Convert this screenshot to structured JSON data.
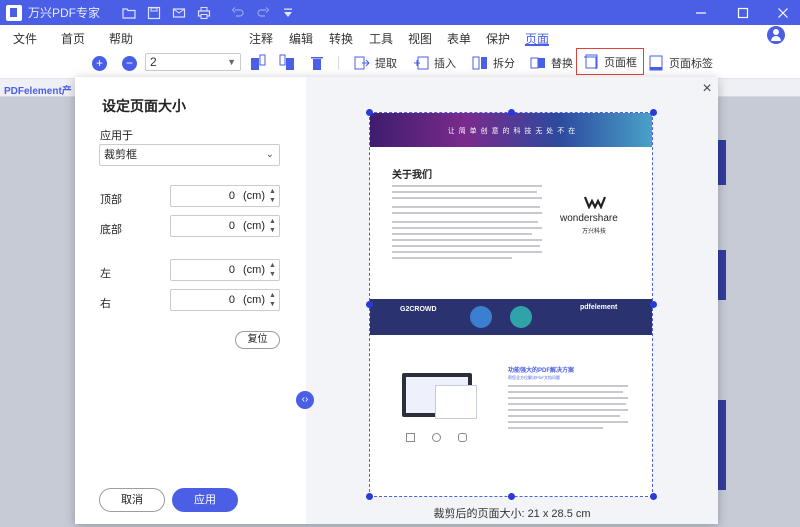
{
  "app": {
    "title": "万兴PDF专家"
  },
  "menu": {
    "file": "文件",
    "home": "首页",
    "help": "帮助",
    "annotate": "注释",
    "edit": "编辑",
    "convert": "转换",
    "tools": "工具",
    "view": "视图",
    "form": "表单",
    "protect": "保护",
    "page": "页面"
  },
  "toolbar": {
    "page_number": "2",
    "extract": "提取",
    "insert": "插入",
    "split": "拆分",
    "replace": "替换",
    "page_box": "页面框",
    "page_label": "页面标签"
  },
  "tab": {
    "label": "PDFelement产"
  },
  "dialog": {
    "title": "设定页面大小",
    "apply_to_label": "应用于",
    "apply_to_value": "裁剪框",
    "top_label": "顶部",
    "bottom_label": "底部",
    "left_label": "左",
    "right_label": "右",
    "top_value": "0",
    "bottom_value": "0",
    "left_value": "0",
    "right_value": "0",
    "unit": "(cm)",
    "reset": "复位",
    "cancel": "取消",
    "apply": "应用",
    "page_size_text": "裁剪后的页面大小:  21 x 28.5 cm"
  },
  "preview": {
    "banner_text": "让 简 单 创 意 的 科 技 无 处 不 在",
    "about_title": "关于我们",
    "brand": "wondershare",
    "brand_cn": "万兴科技",
    "g2": "G2CROWD",
    "pdfelement": "pdfelement",
    "feature_title": "功能强大的PDF解决方案",
    "feature_sub": "帮您全方位解决PDF文档问题"
  },
  "colors": {
    "accent": "#4a5ee6",
    "banner_dark": "#2a3370",
    "highlight_border": "#e0413a"
  }
}
